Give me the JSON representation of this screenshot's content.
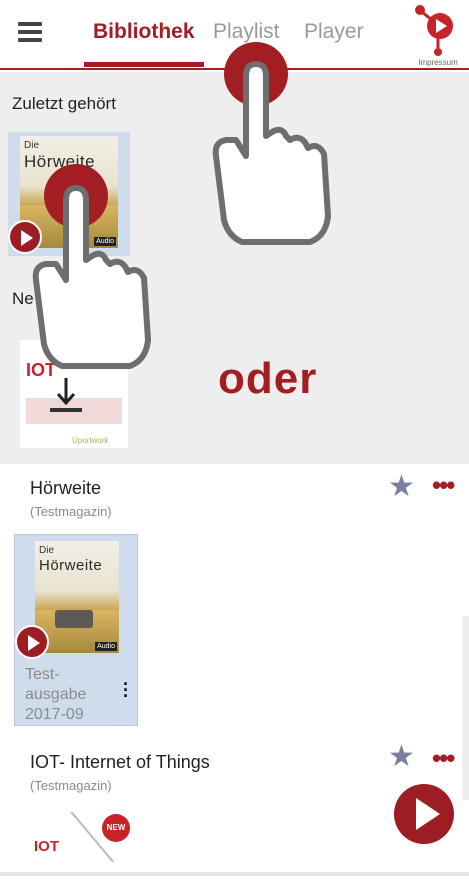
{
  "header": {
    "tabs": [
      {
        "label": "Bibliothek",
        "active": true
      },
      {
        "label": "Playlist",
        "active": false
      },
      {
        "label": "Player",
        "active": false
      }
    ],
    "logo_label": "Impressum",
    "accent_color": "#a31e22"
  },
  "recent": {
    "title": "Zuletzt gehört",
    "cover": {
      "die": "Die",
      "title": "Hörweite",
      "badge": "Audio"
    }
  },
  "new_section": {
    "title_visible": "Ne",
    "iot_logo": "IOT",
    "iot_sub": "Uportwork"
  },
  "overlay_text": "oder",
  "magazines": [
    {
      "title": "Hörweite",
      "subtitle": "(Testmagazin)",
      "issue": {
        "cover_die": "Die",
        "cover_title": "Hörweite",
        "badge": "Audio",
        "label_lines": [
          "Test-",
          "ausgabe",
          "2017-09"
        ]
      }
    },
    {
      "title": "IOT- Internet of Things",
      "subtitle": "(Testmagazin)",
      "thumb": {
        "logo": "IOT",
        "new_badge": "NEW"
      }
    }
  ],
  "icons": {
    "star": "★",
    "more": "•••",
    "kebab": "⋮"
  }
}
